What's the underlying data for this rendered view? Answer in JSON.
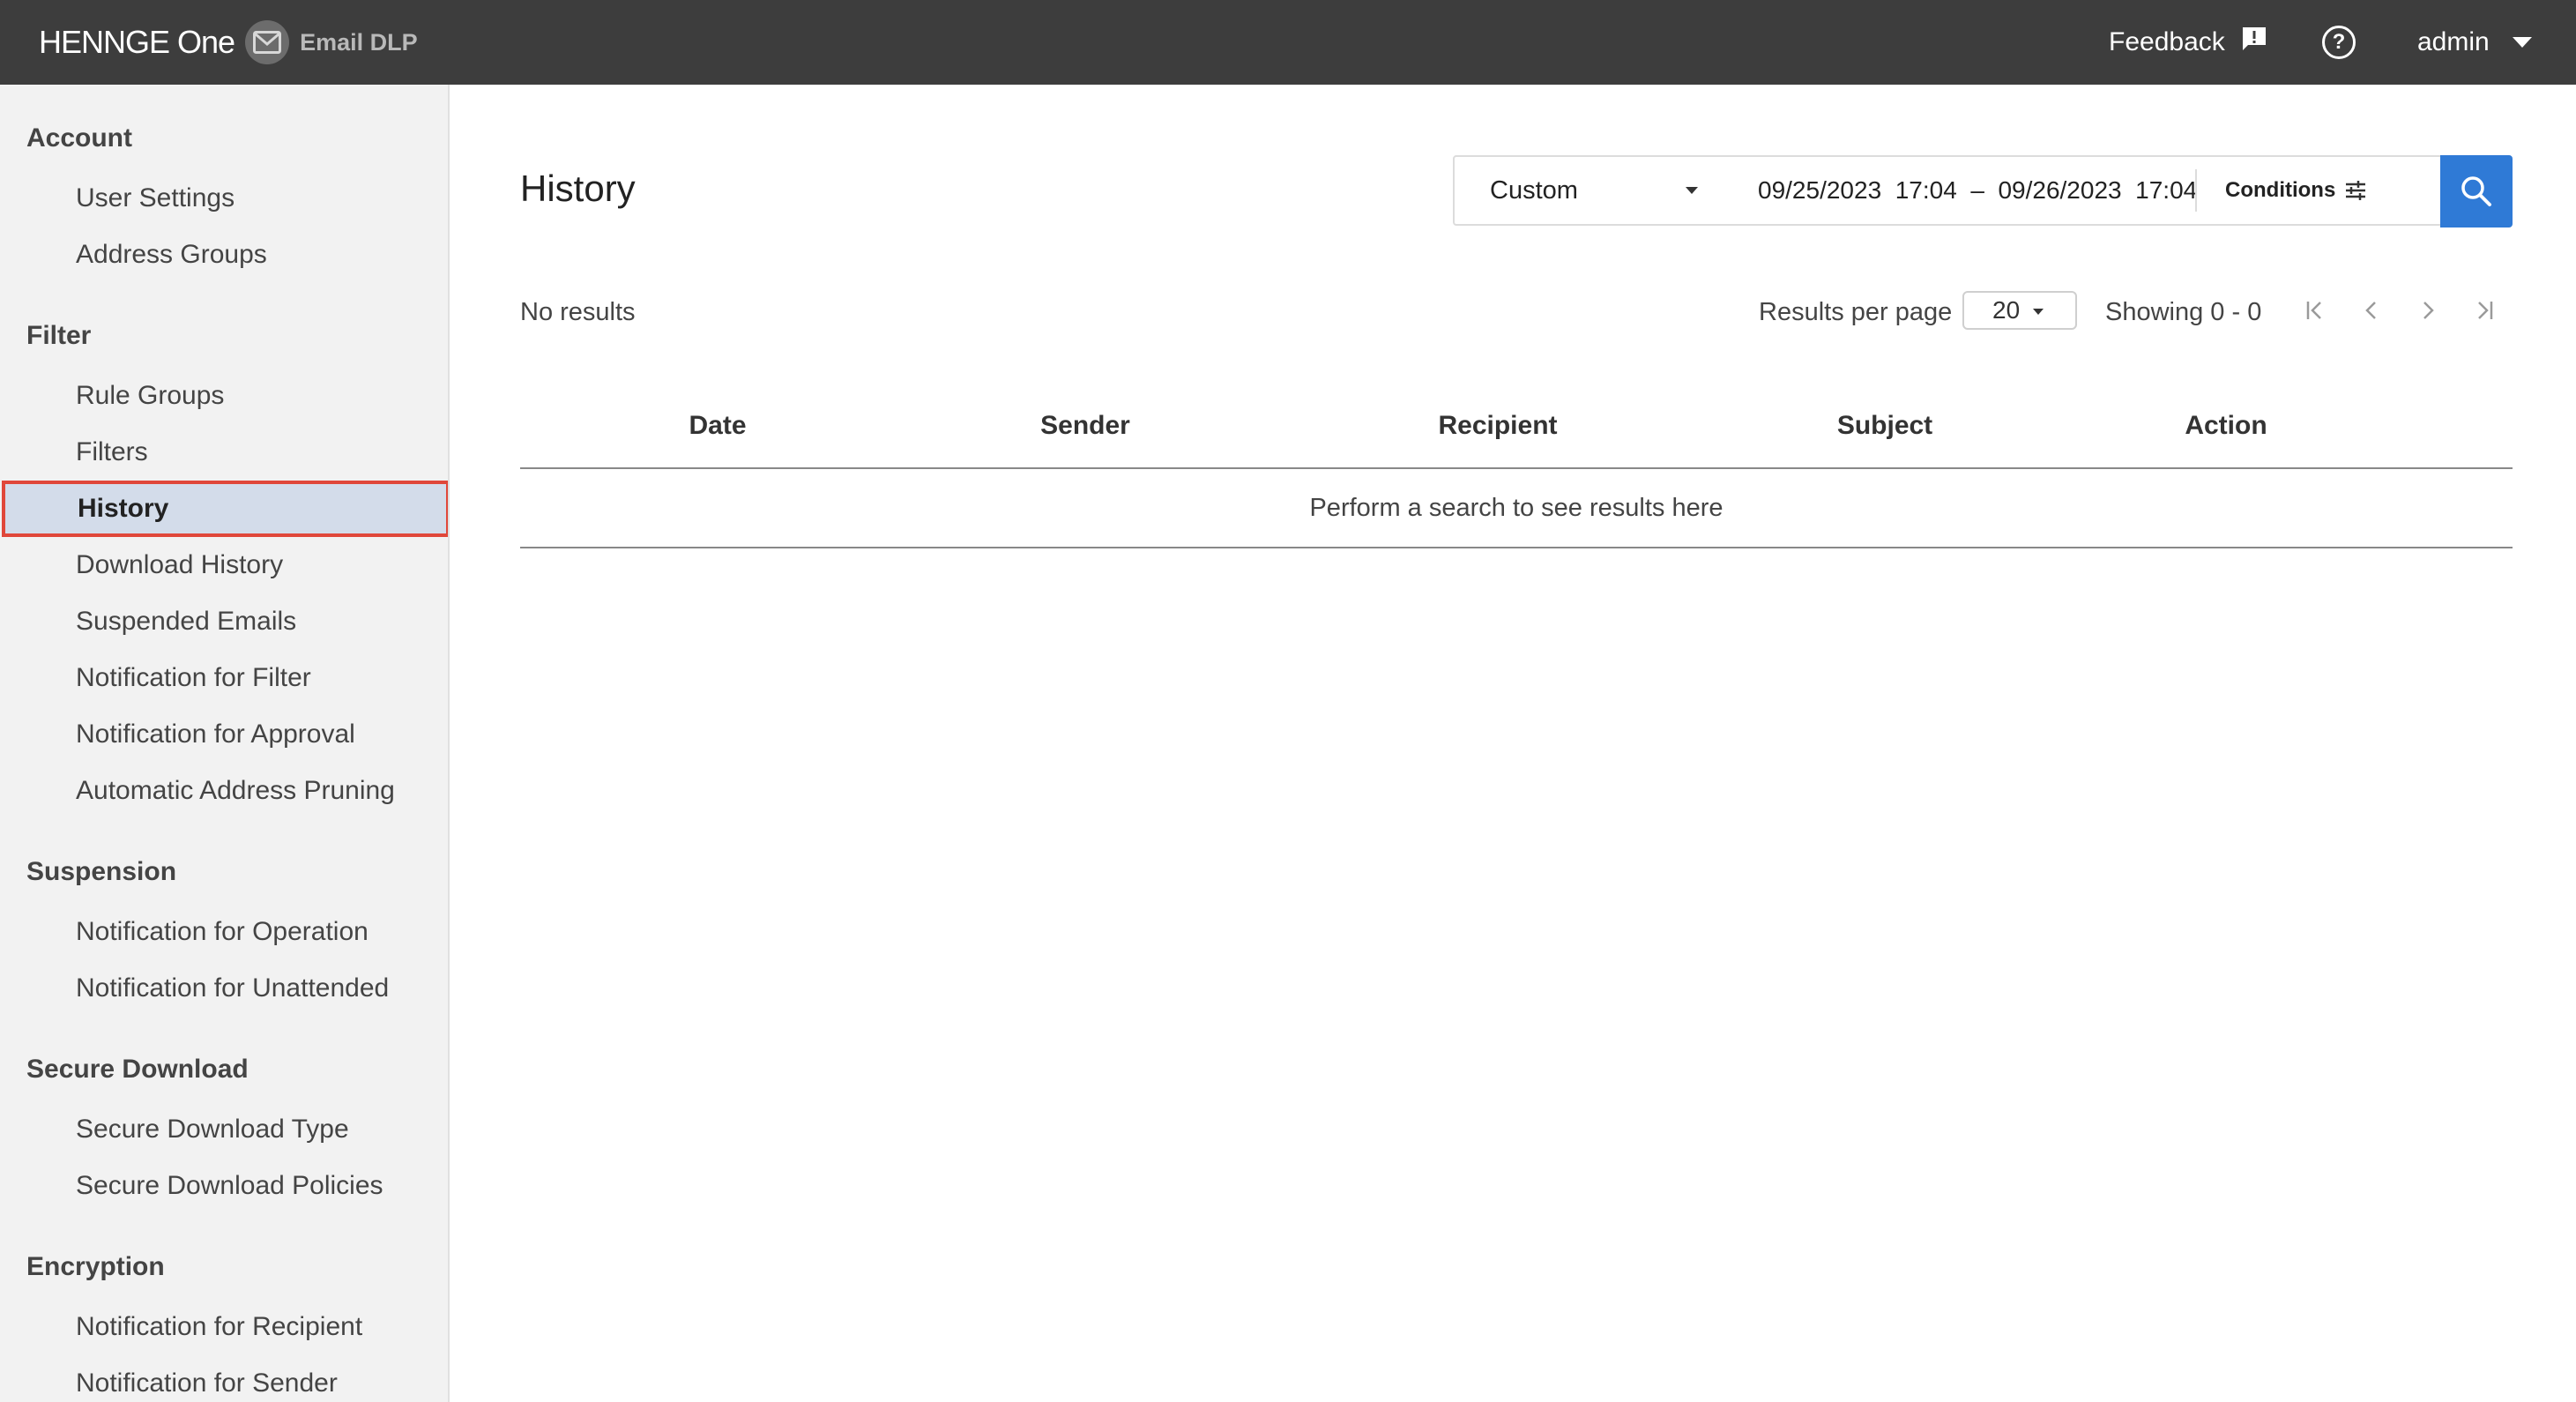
{
  "header": {
    "brand": "HENNGE One",
    "product": "Email DLP",
    "feedback_label": "Feedback",
    "help_symbol": "?",
    "user": "admin",
    "icons": {
      "mail": "mail-icon",
      "feedback": "feedback-icon",
      "help": "help-icon",
      "menu": "chevron-down-icon"
    }
  },
  "sidebar": {
    "sections": [
      {
        "title": "Account",
        "items": [
          "User Settings",
          "Address Groups"
        ]
      },
      {
        "title": "Filter",
        "items": [
          "Rule Groups",
          "Filters",
          "History",
          "Download History",
          "Suspended Emails",
          "Notification for Filter",
          "Notification for Approval",
          "Automatic Address Pruning"
        ]
      },
      {
        "title": "Suspension",
        "items": [
          "Notification for Operation",
          "Notification for Unattended"
        ]
      },
      {
        "title": "Secure Download",
        "items": [
          "Secure Download Type",
          "Secure Download Policies"
        ]
      },
      {
        "title": "Encryption",
        "items": [
          "Notification for Recipient",
          "Notification for Sender"
        ]
      }
    ],
    "active_item": "History"
  },
  "main": {
    "title": "History",
    "search": {
      "range_option": "Custom",
      "date_range": "09/25/2023  17:04  –  09/26/2023  17:04",
      "conditions_label": "Conditions"
    },
    "results_status": "No results",
    "results_per_page_label": "Results per page",
    "results_per_page_value": "20",
    "showing": "Showing 0 - 0",
    "table": {
      "columns": [
        "Date",
        "Sender",
        "Recipient",
        "Subject",
        "Action"
      ],
      "empty_message": "Perform a search to see results here"
    }
  },
  "colors": {
    "header_bg": "#3d3d3d",
    "sidebar_bg": "#f2f2f2",
    "active_item_bg": "#d3dcea",
    "active_item_border": "#e0473a",
    "search_button": "#2f7ad6"
  }
}
